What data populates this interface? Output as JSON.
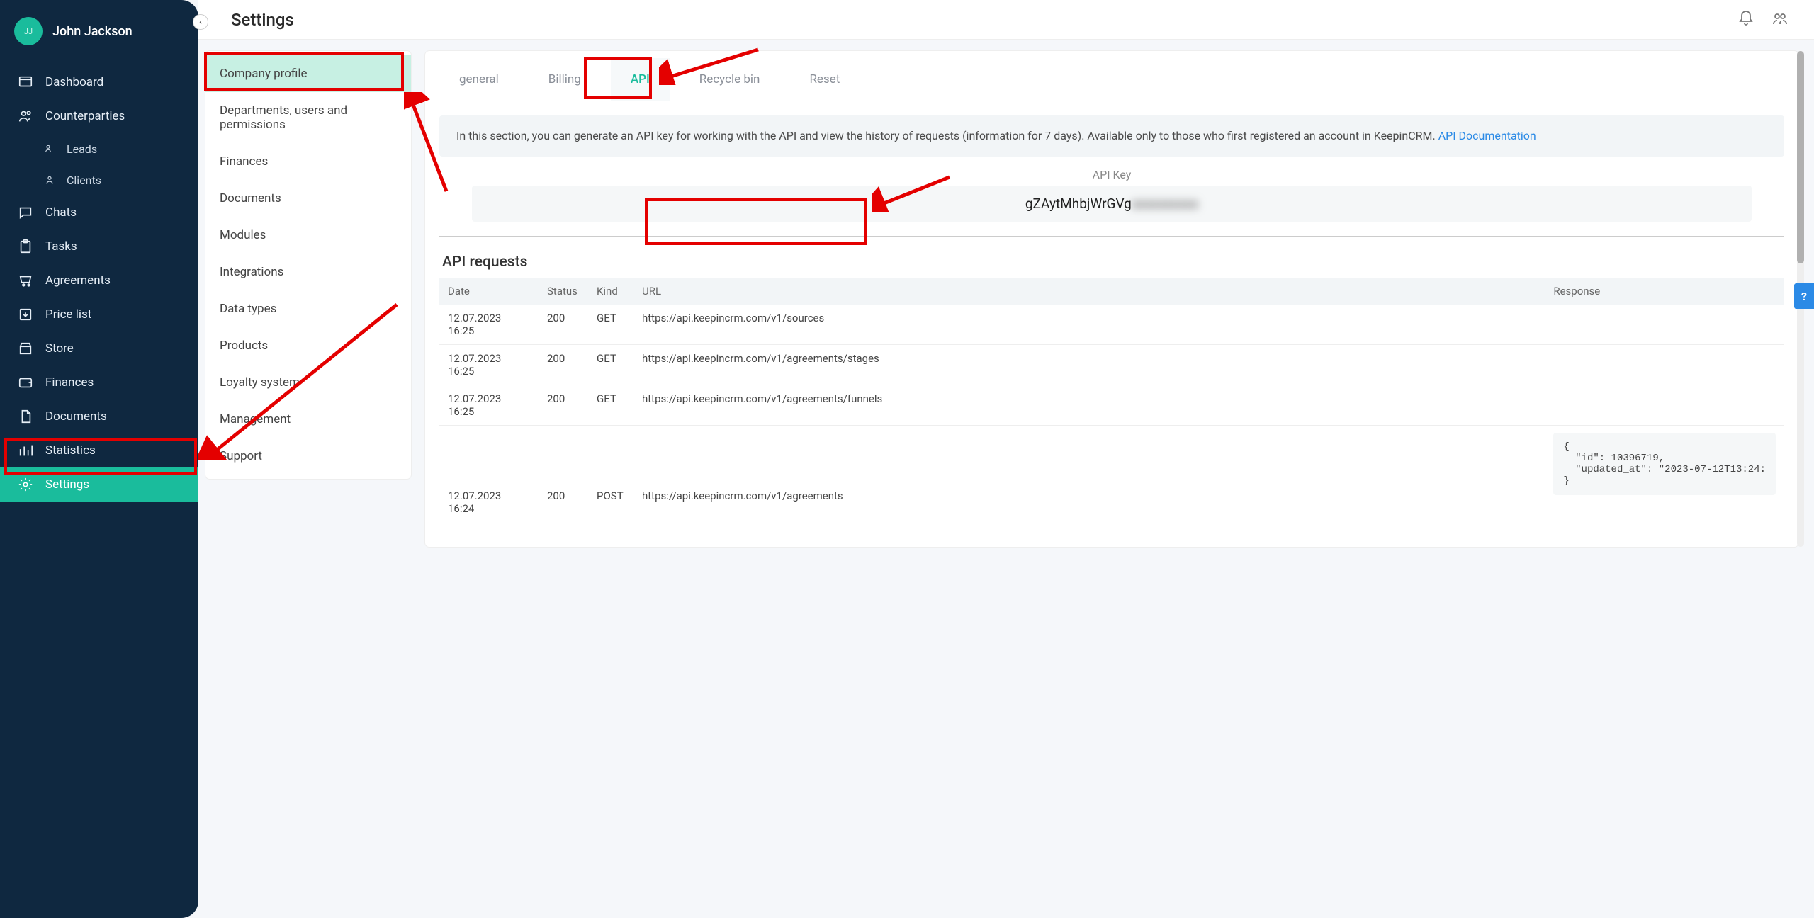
{
  "user": {
    "initials": "JJ",
    "name": "John Jackson"
  },
  "pageTitle": "Settings",
  "sidebar": {
    "items": [
      {
        "label": "Dashboard"
      },
      {
        "label": "Counterparties"
      },
      {
        "label": "Leads",
        "sub": true
      },
      {
        "label": "Clients",
        "sub": true
      },
      {
        "label": "Chats"
      },
      {
        "label": "Tasks"
      },
      {
        "label": "Agreements"
      },
      {
        "label": "Price list"
      },
      {
        "label": "Store"
      },
      {
        "label": "Finances"
      },
      {
        "label": "Documents"
      },
      {
        "label": "Statistics"
      },
      {
        "label": "Settings",
        "active": true
      }
    ]
  },
  "settingsMenu": [
    "Company profile",
    "Departments, users and permissions",
    "Finances",
    "Documents",
    "Modules",
    "Integrations",
    "Data types",
    "Products",
    "Loyalty system",
    "Management",
    "Support"
  ],
  "tabs": [
    "general",
    "Billing",
    "API",
    "Recycle bin",
    "Reset"
  ],
  "activeTab": "API",
  "banner": {
    "text": "In this section, you can generate an API key for working with the API and view the history of requests (information for 7 days). Available only to those who first registered an account in KeepinCRM. ",
    "link": "API Documentation"
  },
  "apiKey": {
    "label": "API Key",
    "visible": "gZAytMhbjWrGVg",
    "hidden": "xxxxxxxxxx"
  },
  "requests": {
    "title": "API requests",
    "headers": [
      "Date",
      "Status",
      "Kind",
      "URL",
      "Response"
    ],
    "rows": [
      {
        "date": "12.07.2023 16:25",
        "status": "200",
        "kind": "GET",
        "url": "https://api.keepincrm.com/v1/sources",
        "response": ""
      },
      {
        "date": "12.07.2023 16:25",
        "status": "200",
        "kind": "GET",
        "url": "https://api.keepincrm.com/v1/agreements/stages",
        "response": ""
      },
      {
        "date": "12.07.2023 16:25",
        "status": "200",
        "kind": "GET",
        "url": "https://api.keepincrm.com/v1/agreements/funnels",
        "response": ""
      },
      {
        "date": "12.07.2023 16:24",
        "status": "200",
        "kind": "POST",
        "url": "https://api.keepincrm.com/v1/agreements",
        "response": "{\n  \"id\": 10396719,\n  \"updated_at\": \"2023-07-12T13:24:\n}"
      }
    ]
  },
  "help": "?"
}
